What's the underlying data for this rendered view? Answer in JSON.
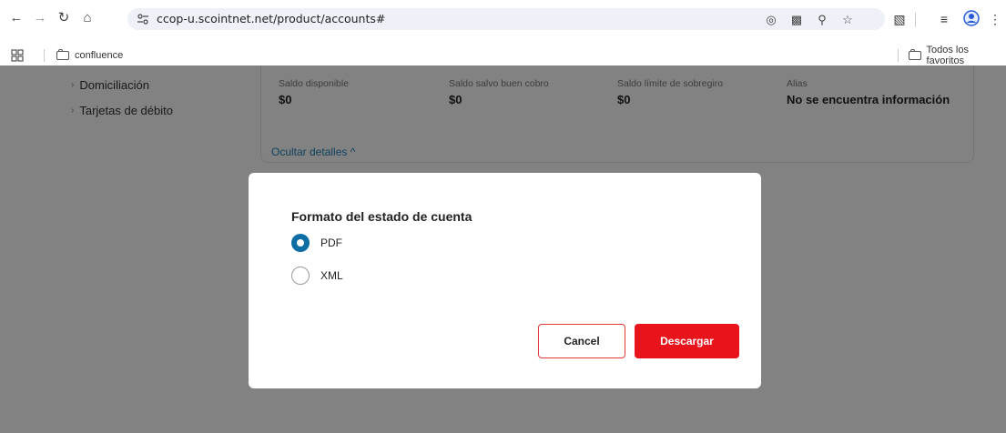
{
  "browser": {
    "url": "ccop-u.scointnet.net/product/accounts#",
    "bookmarks": [
      {
        "label": "confluence"
      }
    ],
    "all_bookmarks_label": "Todos los favoritos",
    "icons": [
      "back-icon",
      "forward-icon",
      "reload-icon",
      "home-icon",
      "site-info-icon",
      "location-icon",
      "translate-icon",
      "zoom-icon",
      "star-icon",
      "extensions-icon",
      "reading-list-icon",
      "profile-icon",
      "more-icon",
      "apps-grid-icon",
      "folder-icon"
    ]
  },
  "sidebar": {
    "items": [
      {
        "label": "Domiciliación"
      },
      {
        "label": "Tarjetas de débito"
      }
    ]
  },
  "account_details": {
    "balances": [
      {
        "label": "Saldo disponible",
        "value": "$0"
      },
      {
        "label": "Saldo salvo buen cobro",
        "value": "$0"
      },
      {
        "label": "Saldo límite de sobregiro",
        "value": "$0"
      },
      {
        "label": "Alias",
        "value": "No se encuentra información"
      }
    ],
    "toggle_label": "Ocultar detalles ^"
  },
  "modal": {
    "title": "Formato del estado de cuenta",
    "options": [
      {
        "label": "PDF",
        "selected": true
      },
      {
        "label": "XML",
        "selected": false
      }
    ],
    "cancel_label": "Cancel",
    "confirm_label": "Descargar"
  },
  "colors": {
    "accent_blue": "#0c6ea3",
    "primary_red": "#e8131b",
    "link_blue": "#1c7fb7"
  }
}
